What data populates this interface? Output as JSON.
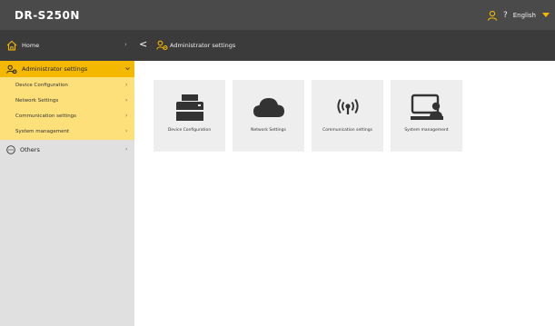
{
  "app": {
    "brand": "DR-S250N"
  },
  "header": {
    "help": "?",
    "language": "English"
  },
  "subbar": {
    "home_label": "Home",
    "breadcrumb": "Administrator settings"
  },
  "sidebar": {
    "section_label": "Administrator settings",
    "items": [
      {
        "label": "Device Configuration"
      },
      {
        "label": "Network Settings"
      },
      {
        "label": "Communication settings"
      },
      {
        "label": "System management"
      }
    ],
    "others_label": "Others"
  },
  "cards": [
    {
      "label": "Device Configuration",
      "icon": "printer-icon"
    },
    {
      "label": "Network Settings",
      "icon": "cloud-icon"
    },
    {
      "label": "Communication settings",
      "icon": "wireless-icon"
    },
    {
      "label": "System management",
      "icon": "system-user-icon"
    }
  ],
  "colors": {
    "accent": "#f5b800",
    "accent_light": "#fde07a",
    "topbar": "#4a4a4a",
    "subbar": "#3b3b3b",
    "sidebar": "#e0e0e0",
    "card": "#eeeeee"
  }
}
